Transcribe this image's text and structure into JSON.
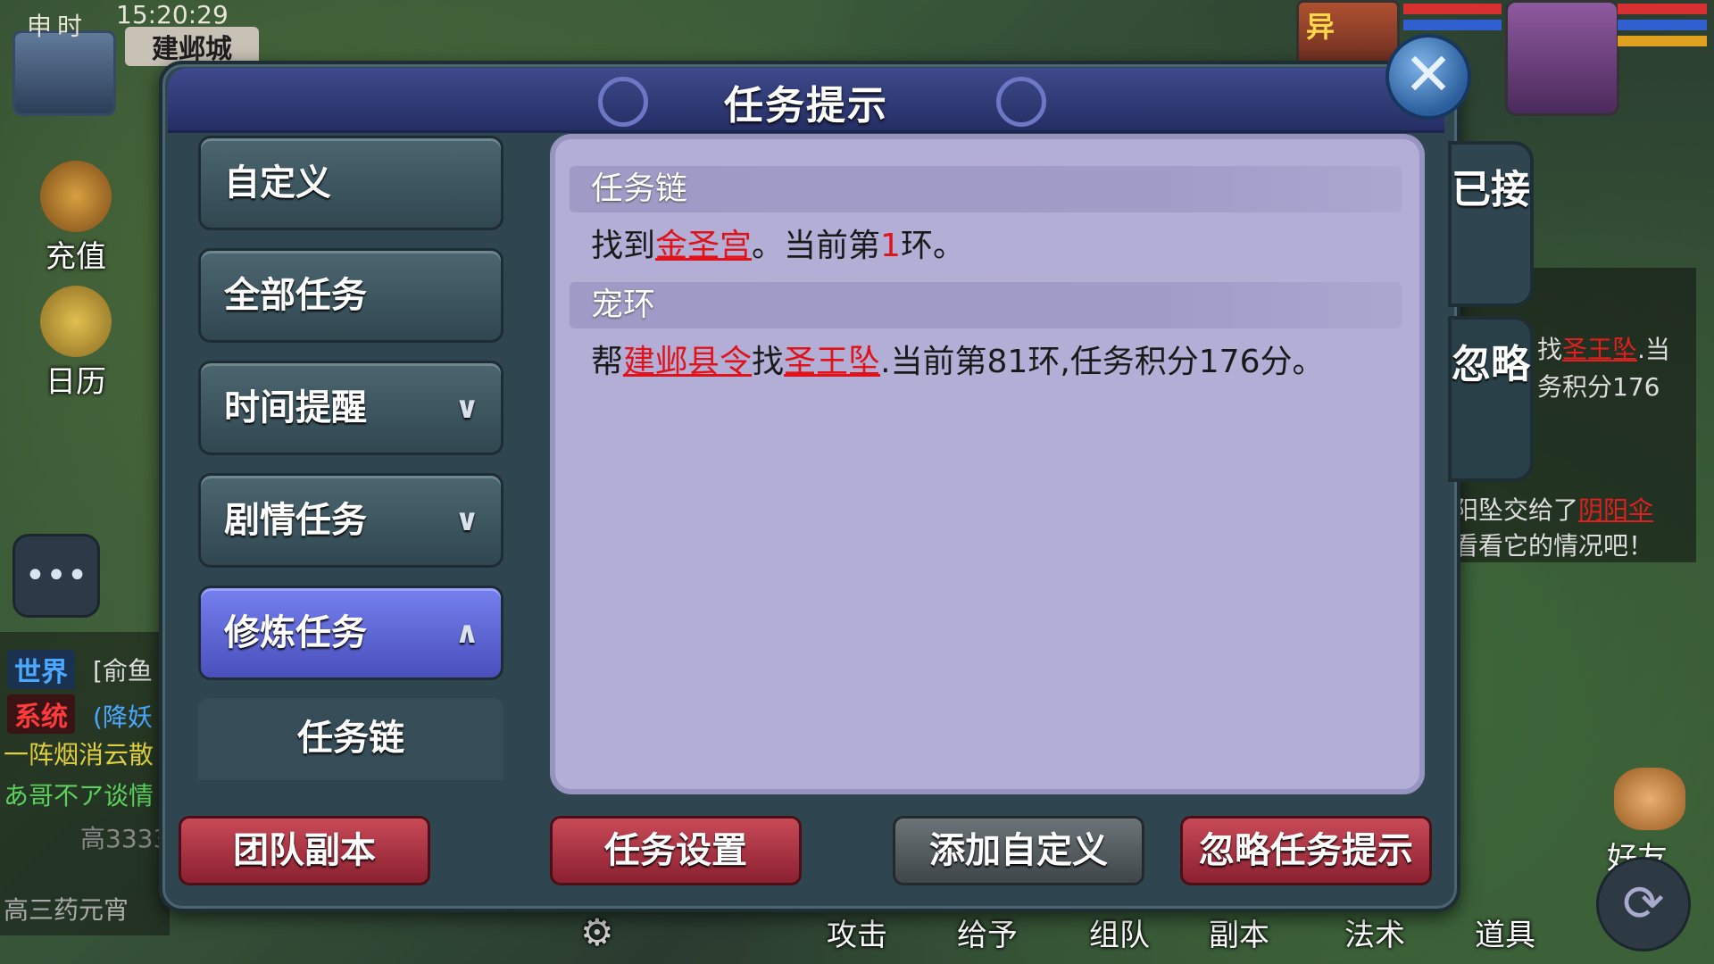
{
  "hud": {
    "shichen": "申时",
    "clock": "15:20:29",
    "city": "建邺城",
    "recharge": "充值",
    "calendar": "日历",
    "chat_tags": [
      {
        "label": "世界",
        "color": "#4aa8ff"
      },
      {
        "label": "系统",
        "color": "#ff3a3a"
      }
    ],
    "chat_lines": [
      "[俞鱼",
      "(降妖",
      "一阵烟消云散",
      "あ哥不ア谈情",
      "高3333",
      "高三药元宵"
    ],
    "right_panel": {
      "line1_prefix": "找",
      "line1_link": "圣王坠",
      "line1_suffix": ".当",
      "line2": "务积分176",
      "line3_prefix": "阳坠交给了",
      "line3_link": "阴阳伞",
      "line4": "看看它的情况吧！"
    },
    "bottom_items": [
      "攻击",
      "给予",
      "组队",
      "副本",
      "法术",
      "道具"
    ],
    "friend": "好友",
    "avatar_tag": "异"
  },
  "dialog": {
    "title": "任务提示",
    "close": "✕",
    "menu": [
      {
        "label": "自定义",
        "chevron": ""
      },
      {
        "label": "全部任务",
        "chevron": ""
      },
      {
        "label": "时间提醒",
        "chevron": "∨"
      },
      {
        "label": "剧情任务",
        "chevron": "∨"
      },
      {
        "label": "修炼任务",
        "chevron": "∧",
        "active": true
      }
    ],
    "sub_item": "任务链",
    "sections": [
      {
        "header": "任务链",
        "prefix": "找到",
        "link1": "金圣宫",
        "mid1": "。当前第",
        "num": "1",
        "suffix": "环。"
      },
      {
        "header": "宠环",
        "prefix": "帮",
        "link1": "建邺县令",
        "mid1": "找",
        "link2": "圣王坠",
        "suffix": ".当前第81环,任务积分176分。"
      }
    ],
    "side_tabs": [
      "已接",
      "忽略"
    ],
    "footer": {
      "team_dungeon": "团队副本",
      "task_settings": "任务设置",
      "add_custom": "添加自定义",
      "ignore_hint": "忽略任务提示"
    }
  }
}
